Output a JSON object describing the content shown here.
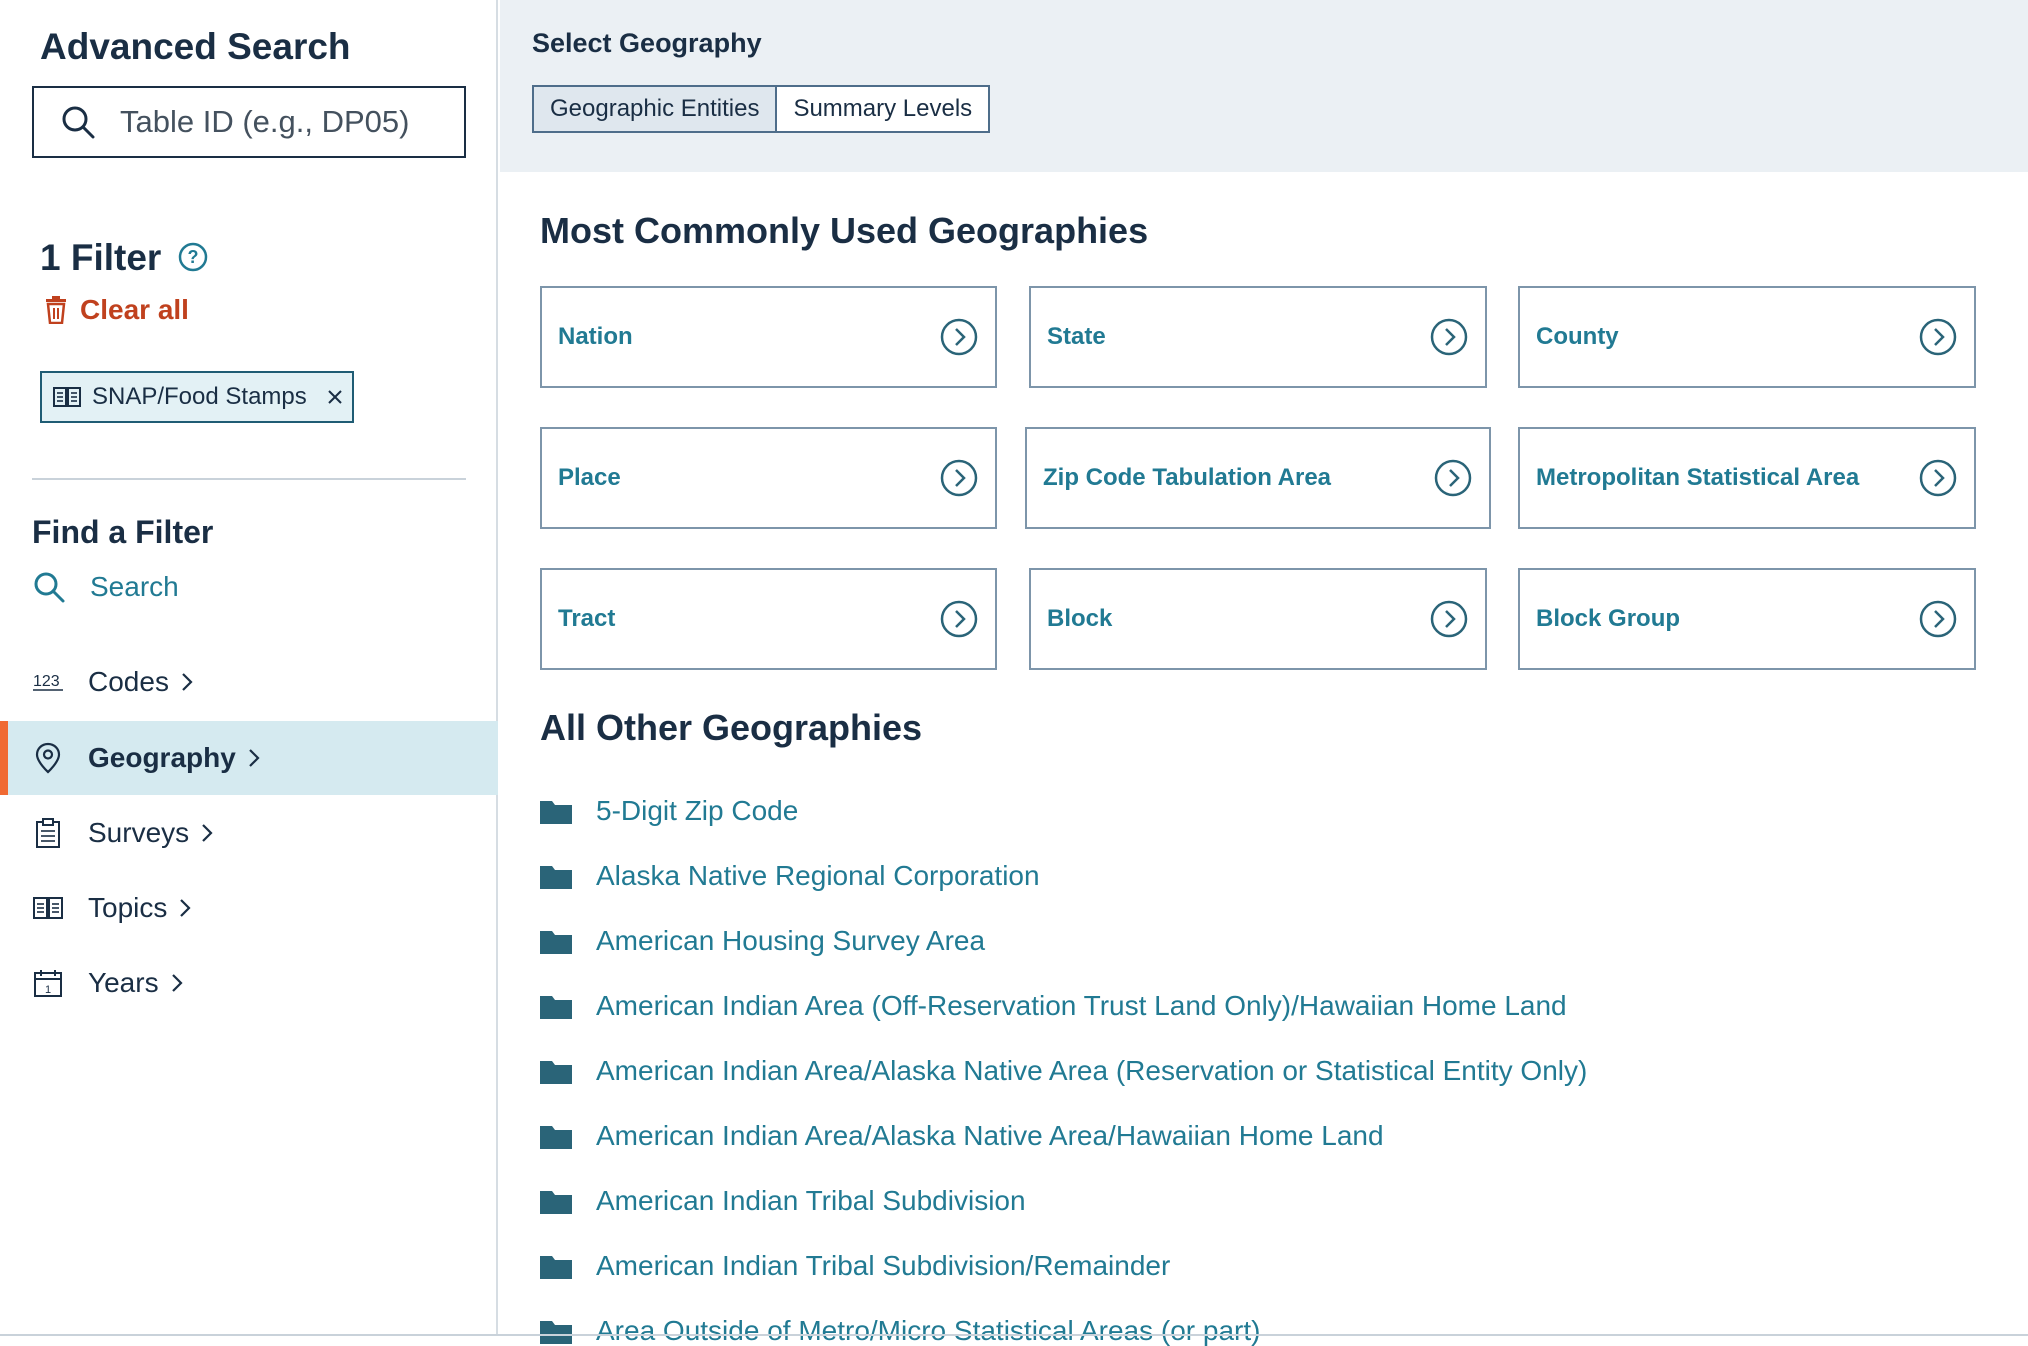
{
  "sidebar": {
    "title": "Advanced Search",
    "search_placeholder": "Table ID (e.g., DP05)",
    "filter_count": "1 Filter",
    "clear_all": "Clear all",
    "chip_label": "SNAP/Food Stamps",
    "find_title": "Find a Filter",
    "find_search": "Search",
    "nav": [
      {
        "label": "Codes",
        "icon": "codes-123-icon"
      },
      {
        "label": "Geography",
        "icon": "map-pin-icon",
        "active": true
      },
      {
        "label": "Surveys",
        "icon": "clipboard-icon"
      },
      {
        "label": "Topics",
        "icon": "book-icon"
      },
      {
        "label": "Years",
        "icon": "calendar-icon"
      }
    ]
  },
  "main": {
    "select_title": "Select Geography",
    "tabs": [
      {
        "label": "Geographic Entities",
        "active": true
      },
      {
        "label": "Summary Levels",
        "active": false
      }
    ],
    "common_title": "Most Commonly Used Geographies",
    "common": [
      "Nation",
      "State",
      "County",
      "Place",
      "Zip Code Tabulation Area",
      "Metropolitan Statistical Area",
      "Tract",
      "Block",
      "Block Group"
    ],
    "other_title": "All Other Geographies",
    "other": [
      "5-Digit Zip Code",
      "Alaska Native Regional Corporation",
      "American Housing Survey Area",
      "American Indian Area (Off-Reservation Trust Land Only)/Hawaiian Home Land",
      "American Indian Area/Alaska Native Area (Reservation or Statistical Entity Only)",
      "American Indian Area/Alaska Native Area/Hawaiian Home Land",
      "American Indian Tribal Subdivision",
      "American Indian Tribal Subdivision/Remainder",
      "Area Outside of Metro/Micro Statistical Areas (or part)"
    ]
  },
  "colors": {
    "navy": "#1a2e44",
    "teal_link": "#217a93",
    "clear_red": "#c0411e",
    "active_bg": "#d5eaf0",
    "active_accent": "#f06a33",
    "topbar_bg": "#ebf0f4",
    "folder": "#2a6478"
  }
}
